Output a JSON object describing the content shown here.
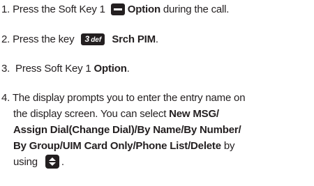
{
  "steps": [
    {
      "number": "1.",
      "before": " Press the Soft Key 1 ",
      "bold": "Option",
      "after": " during the call.",
      "icon": "softkey-icon"
    },
    {
      "number": "2.",
      "before": " Press the key ",
      "key_number": "3",
      "key_letters": "def",
      "bold": "Srch PIM",
      "after": ".",
      "icon": "digit-3-key-icon"
    },
    {
      "number": "3.",
      "before": "  Press Soft Key 1 ",
      "bold": "Option",
      "after": "."
    },
    {
      "number": "4.",
      "line1": " The display prompts you to enter the entry name on",
      "line2_before": "the display screen. You can select ",
      "line2_bold": "New MSG/",
      "line3_bold": "Assign Dial(Change Dial)/By Name/By Number/",
      "line4_bold": "By Group/UIM Card Only/Phone List/Delete",
      "line4_after": " by",
      "line5_before": "using ",
      "line5_after": ".",
      "icon": "nav-key-icon"
    }
  ]
}
